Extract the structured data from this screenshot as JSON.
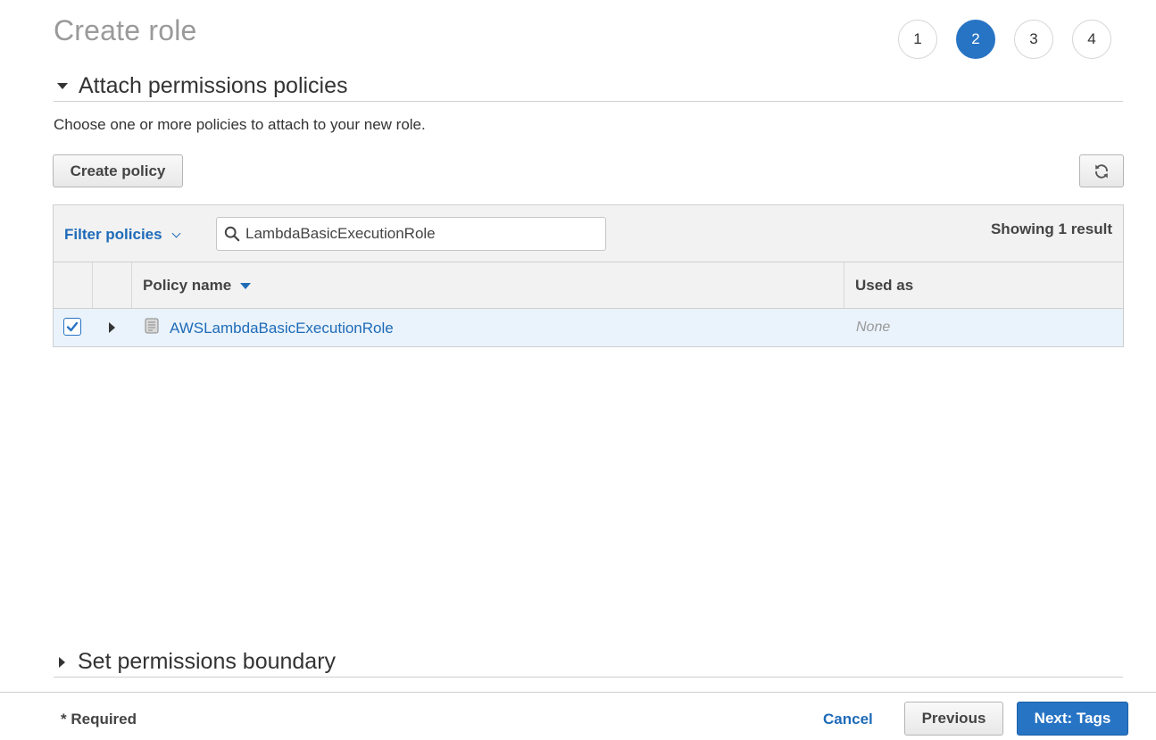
{
  "page": {
    "title": "Create role"
  },
  "steps": [
    "1",
    "2",
    "3",
    "4"
  ],
  "active_step": "2",
  "attach_section": {
    "title": "Attach permissions policies",
    "description": "Choose one or more policies to attach to your new role.",
    "create_policy_label": "Create policy",
    "refresh_icon": "refresh-icon"
  },
  "filter": {
    "label": "Filter policies",
    "search_value": "LambdaBasicExecutionRole",
    "result_count": "Showing 1 result"
  },
  "table": {
    "columns": {
      "policy_name": "Policy name",
      "used_as": "Used as"
    },
    "rows": [
      {
        "checked": true,
        "policy_name": "AWSLambdaBasicExecutionRole",
        "used_as": "None"
      }
    ]
  },
  "boundary_section": {
    "title": "Set permissions boundary"
  },
  "footer": {
    "required": "* Required",
    "cancel": "Cancel",
    "previous": "Previous",
    "next": "Next: Tags"
  },
  "colors": {
    "accent": "#2874c4",
    "link": "#1e6bb8",
    "row_selected": "#eaf3fb"
  }
}
